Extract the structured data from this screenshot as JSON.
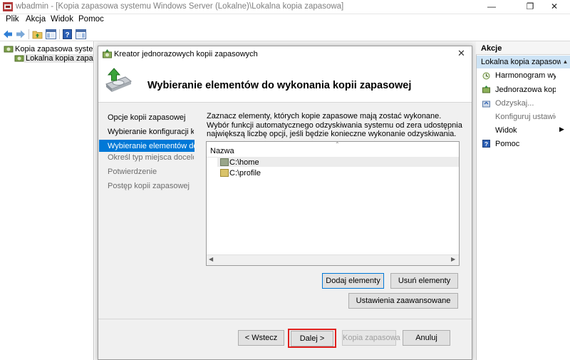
{
  "window": {
    "title": "wbadmin - [Kopia zapasowa systemu Windows Server (Lokalne)\\Lokalna kopia zapasowa]",
    "controls": [
      "—",
      "❐",
      "✕"
    ]
  },
  "menu": [
    "Plik",
    "Akcja",
    "Widok",
    "Pomoc"
  ],
  "tree": {
    "root": "Kopia zapasowa systemu Windows Server (Lokalne)",
    "child": "Lokalna kopia zapasowa"
  },
  "actions": {
    "header": "Akcje",
    "section": "Lokalna kopia zapasowa",
    "items": [
      {
        "label": "Harmonogram wykonywania kopii zapasowych...",
        "icon": "schedule-backup-icon"
      },
      {
        "label": "Jednorazowa kopia zapasowa...",
        "icon": "backup-once-icon"
      },
      {
        "label": "Odzyskaj...",
        "icon": "recover-icon"
      },
      {
        "label": "Konfiguruj ustawienia wydajności...",
        "icon": ""
      },
      {
        "label": "Widok",
        "icon": ""
      },
      {
        "label": "Pomoc",
        "icon": "help-icon"
      }
    ]
  },
  "dialog": {
    "title": "Kreator jednorazowych kopii zapasowych",
    "close": "✕",
    "heading": "Wybieranie elementów do wykonania kopii zapasowej",
    "steps": [
      "Opcje kopii zapasowej",
      "Wybieranie konfiguracji kopii zapasowej",
      "Wybieranie elementów do wykonania kopii zapasowej",
      "Określ typ miejsca docelowego",
      "Potwierdzenie",
      "Postęp kopii zapasowej"
    ],
    "description": "Zaznacz elementy, których kopie zapasowe mają zostać wykonane. Wybór funkcji automatycznego odzyskiwania systemu od zera udostępnia największą liczbę opcji, jeśli będzie konieczne wykonanie odzyskiwania.",
    "list": {
      "column": "Nazwa",
      "items": [
        "C:\\home",
        "C:\\profile"
      ]
    },
    "buttons": {
      "add": "Dodaj elementy",
      "remove": "Usuń elementy",
      "advanced": "Ustawienia zaawansowane",
      "back": "< Wstecz",
      "next": "Dalej >",
      "backup": "Kopia zapasowa",
      "cancel": "Anuluj"
    }
  }
}
